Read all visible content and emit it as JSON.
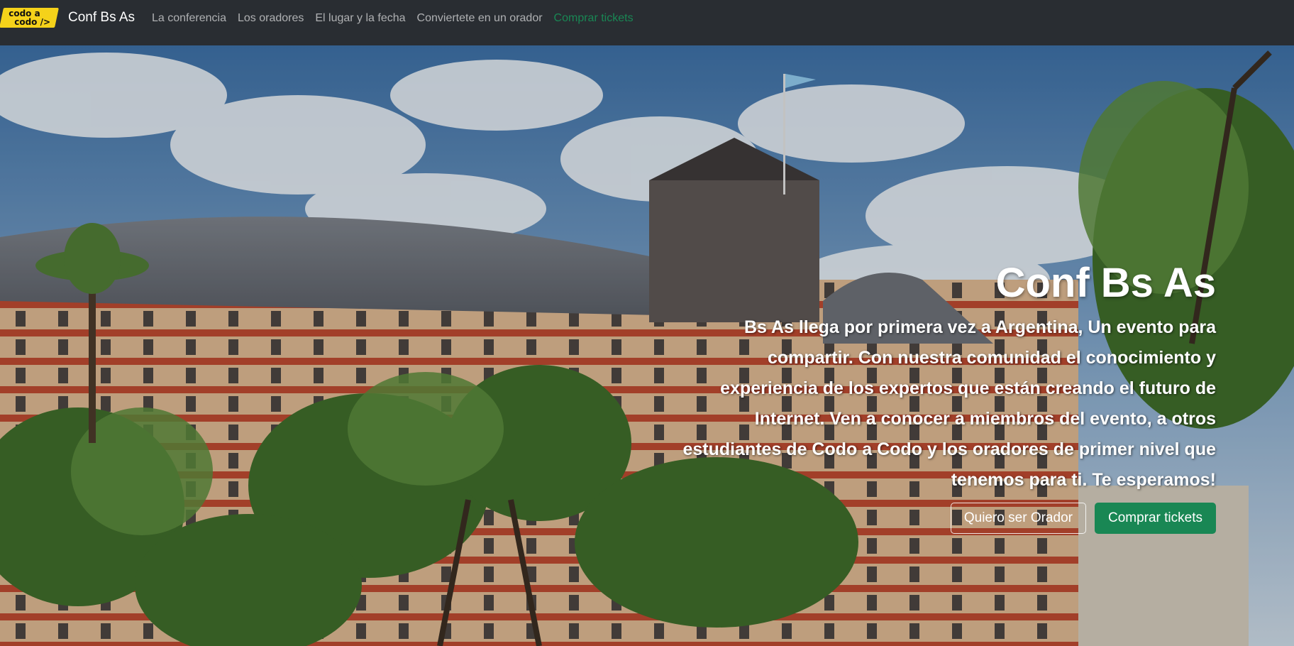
{
  "header": {
    "logo_top": "codo a",
    "logo_bottom": "codo />",
    "brand": "Conf Bs As",
    "nav": [
      "La conferencia",
      "Los oradores",
      "El lugar y la fecha",
      "Conviertete en un orador",
      "Comprar tickets"
    ]
  },
  "hero": {
    "title": "Conf Bs As",
    "text": "Bs As llega por primera vez a Argentina, Un evento para compartir. Con nuestra comunidad el conocimiento y experiencia de los expertos que están creando el futuro de Internet. Ven a conocer a miembros del evento, a otros estudiantes de Codo a Codo y los oradores de primer nivel que tenemos para ti. Te esperamos!",
    "btn_orador": "Quiero ser Orador",
    "btn_tickets": "Comprar tickets"
  },
  "colors": {
    "navbar": "#292d32",
    "accent": "#198754",
    "logo": "#f5d21a"
  }
}
